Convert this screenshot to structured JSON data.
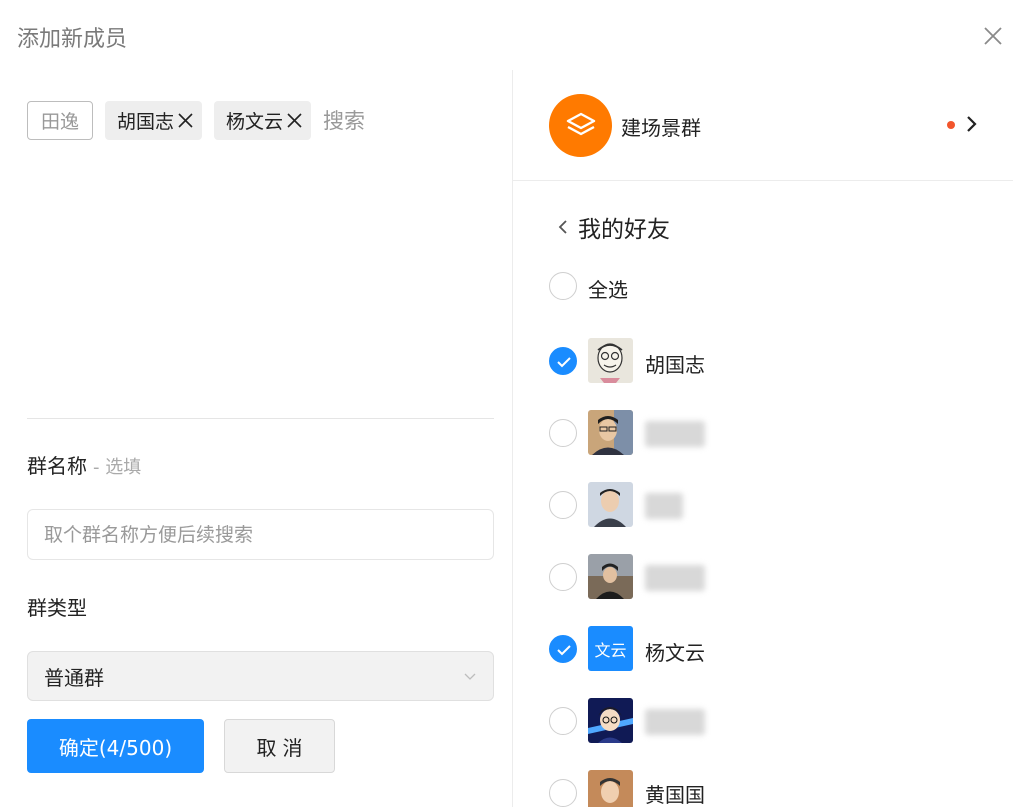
{
  "dialog": {
    "title": "添加新成员"
  },
  "selected": {
    "self_chip": "田逸",
    "chips": [
      "胡国志",
      "杨文云"
    ],
    "search_placeholder": "搜索"
  },
  "form": {
    "name_label": "群名称",
    "name_optional": "- 选填",
    "name_placeholder": "取个群名称方便后续搜索",
    "type_label": "群类型",
    "type_value": "普通群",
    "confirm_label": "确定(4/500)",
    "cancel_label": "取消"
  },
  "org": {
    "name": "建场景群",
    "accent": "#ff7a00",
    "dot_color": "#f2552c"
  },
  "contacts": {
    "breadcrumb": "我的好友",
    "select_all": "全选",
    "list": [
      {
        "name": "胡国志",
        "checked": true,
        "avatar": "sketch-face"
      },
      {
        "name": "",
        "checked": false,
        "avatar": "photo-glasses"
      },
      {
        "name": "",
        "checked": false,
        "avatar": "photo-portrait"
      },
      {
        "name": "",
        "checked": false,
        "avatar": "photo-outdoor"
      },
      {
        "name": "杨文云",
        "checked": true,
        "avatar": "text",
        "avatar_text": "文云"
      },
      {
        "name": "",
        "checked": false,
        "avatar": "anime"
      },
      {
        "name": "黄国国",
        "checked": false,
        "avatar": "photo-partial"
      }
    ]
  },
  "colors": {
    "primary": "#1a8cff",
    "orange": "#ff7a00"
  }
}
